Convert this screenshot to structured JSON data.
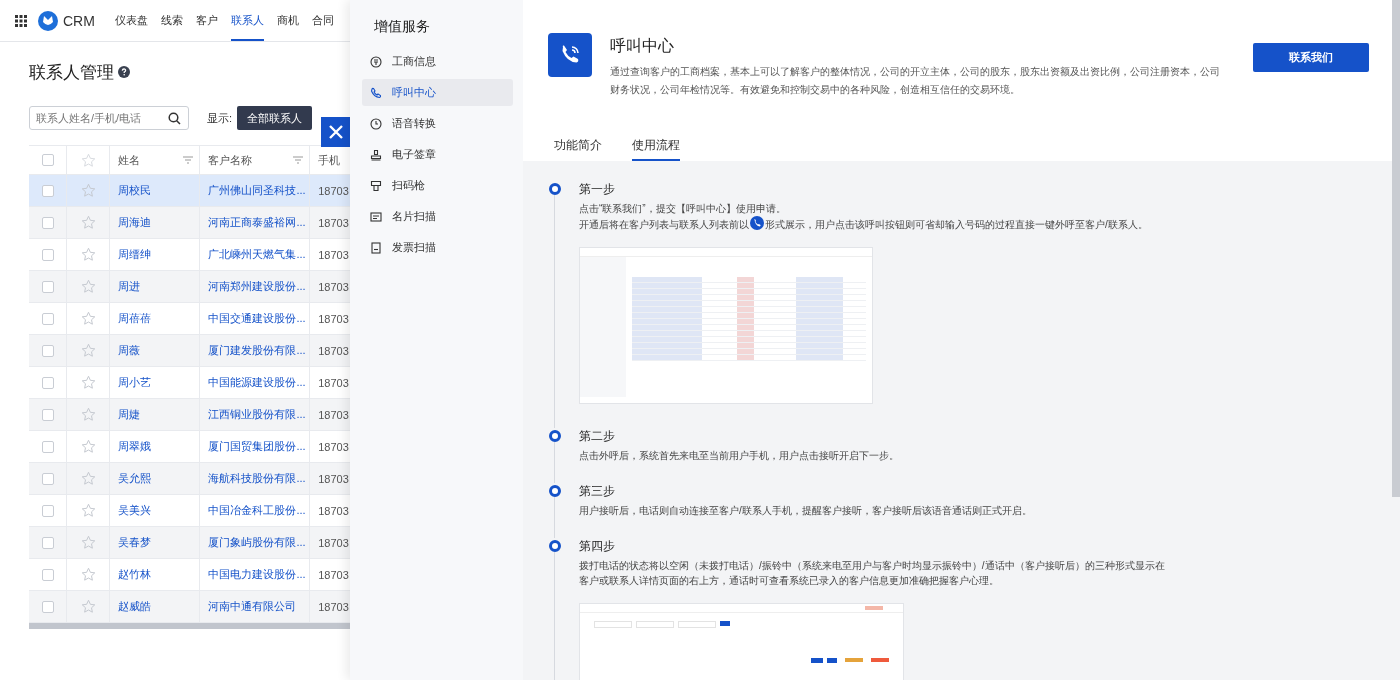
{
  "app": {
    "name": "CRM"
  },
  "nav": [
    {
      "label": "仪表盘",
      "selected": false
    },
    {
      "label": "线索",
      "selected": false
    },
    {
      "label": "客户",
      "selected": false
    },
    {
      "label": "联系人",
      "selected": true
    },
    {
      "label": "商机",
      "selected": false
    },
    {
      "label": "合同",
      "selected": false
    }
  ],
  "page_title": "联系人管理",
  "search": {
    "placeholder": "联系人姓名/手机/电话"
  },
  "filter": {
    "label": "显示:",
    "options": [
      {
        "label": "全部联系人",
        "selected": true
      }
    ]
  },
  "table": {
    "all_checked": false,
    "columns": [
      "姓名",
      "客户名称",
      "手机"
    ],
    "rows": [
      {
        "name": "周校民",
        "customer": "广州佛山同圣科技...",
        "phone": "18703",
        "selected": true
      },
      {
        "name": "周海迪",
        "customer": "河南正商泰盛裕网...",
        "phone": "18703",
        "selected": false
      },
      {
        "name": "周缙绅",
        "customer": "广北嵊州天燃气集...",
        "phone": "18703",
        "selected": false
      },
      {
        "name": "周进",
        "customer": "河南郑州建设股份...",
        "phone": "18703",
        "selected": false
      },
      {
        "name": "周蓓蓓",
        "customer": "中国交通建设股份...",
        "phone": "18703",
        "selected": false
      },
      {
        "name": "周薇",
        "customer": "厦门建发股份有限...",
        "phone": "18703",
        "selected": false
      },
      {
        "name": "周小艺",
        "customer": "中国能源建设股份...",
        "phone": "18703",
        "selected": false
      },
      {
        "name": "周婕",
        "customer": "江西铜业股份有限...",
        "phone": "18703",
        "selected": false
      },
      {
        "name": "周翠娥",
        "customer": "厦门国贸集团股份...",
        "phone": "18703",
        "selected": false
      },
      {
        "name": "吴允熙",
        "customer": "海航科技股份有限...",
        "phone": "18703",
        "selected": false
      },
      {
        "name": "吴美兴",
        "customer": "中国冶金科工股份...",
        "phone": "18703",
        "selected": false
      },
      {
        "name": "吴春梦",
        "customer": "厦门象屿股份有限...",
        "phone": "18703",
        "selected": false
      },
      {
        "name": "赵竹林",
        "customer": "中国电力建设股份...",
        "phone": "18703",
        "selected": false
      },
      {
        "name": "赵威皓",
        "customer": "河南中通有限公司",
        "phone": "18703",
        "selected": false
      }
    ]
  },
  "panel": {
    "menu_title": "增值服务",
    "menu": [
      {
        "label": "工商信息",
        "selected": false
      },
      {
        "label": "呼叫中心",
        "selected": true
      },
      {
        "label": "语音转换",
        "selected": false
      },
      {
        "label": "电子签章",
        "selected": false
      },
      {
        "label": "扫码枪",
        "selected": false
      },
      {
        "label": "名片扫描",
        "selected": false
      },
      {
        "label": "发票扫描",
        "selected": false
      }
    ],
    "title": "呼叫中心",
    "description": "通过查询客户的工商档案，基本上可以了解客户的整体情况，公司的开立主体，公司的股东，股东出资额及出资比例，公司注册资本，公司财务状况，公司年检情况等。有效避免和控制交易中的各种风险，创造相互信任的交易环境。",
    "contact_button": "联系我们",
    "tabs": [
      {
        "label": "功能简介",
        "selected": false
      },
      {
        "label": "使用流程",
        "selected": true
      }
    ],
    "steps": [
      {
        "title": "第一步",
        "paragraphs": [
          {
            "parts": [
              "点击“联系我们”，提交【呼叫中心】使用申请。"
            ]
          },
          {
            "parts": [
              "开通后将在客户列表与联系人列表前以",
              "形式展示，用户点击该呼叫按钮则可省却输入号码的过程直接一键外呼至客户/联系人。"
            ]
          }
        ],
        "screenshot": {
          "kind": "list"
        }
      },
      {
        "title": "第二步",
        "paragraphs": [
          {
            "parts": [
              "点击外呼后，系统首先来电至当前用户手机，用户点击接听开启下一步。"
            ]
          }
        ]
      },
      {
        "title": "第三步",
        "paragraphs": [
          {
            "parts": [
              "用户接听后，电话则自动连接至客户/联系人手机，提醒客户接听，客户接听后该语音通话则正式开启。"
            ]
          }
        ]
      },
      {
        "title": "第四步",
        "paragraphs": [
          {
            "parts": [
              "拨打电话的状态将以空闲（未拨打电话）/振铃中（系统来电至用户与客户时均显示振铃中）/通话中（客户接听后）的三种形式显示在客户或联系人详情页面的右上方，通话时可查看系统已录入的客户信息更加准确把握客户心理。"
            ]
          }
        ],
        "screenshot": {
          "kind": "detail"
        }
      }
    ]
  }
}
